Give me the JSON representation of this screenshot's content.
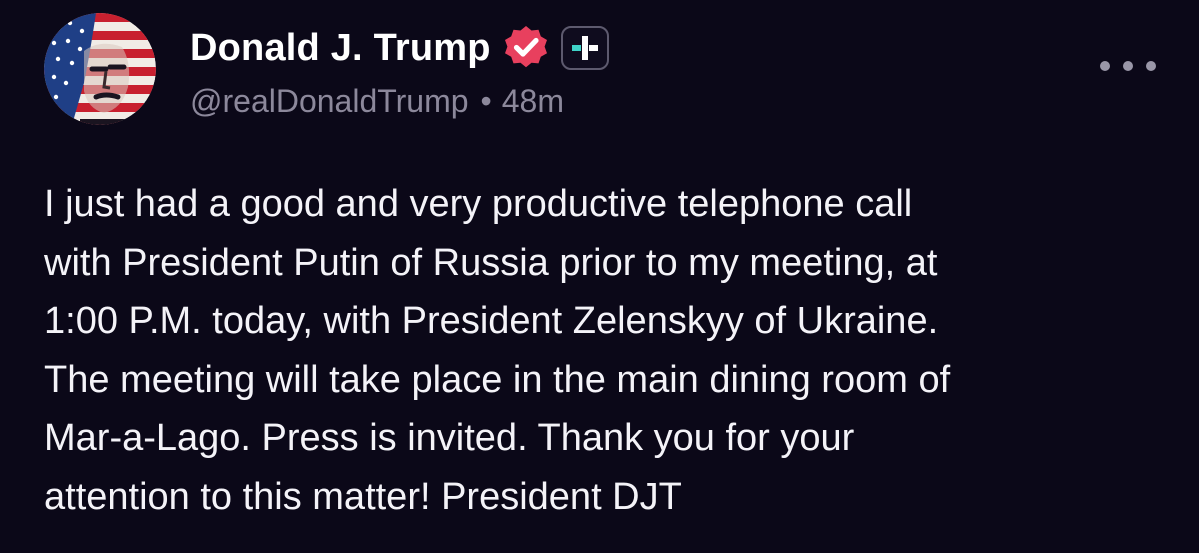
{
  "post": {
    "author": {
      "display_name": "Donald J. Trump",
      "handle": "@realDonaldTrump",
      "verified_icon": "verified-badge-icon",
      "plus_icon": "plus-icon"
    },
    "separator": "•",
    "timestamp": "48m",
    "more_icon": "more-options-icon",
    "text": "I just had a good and very productive telephone call\nwith President Putin of Russia prior to my meeting, at\n1:00 P.M. today, with President Zelenskyy of Ukraine.\nThe meeting will take place in the main dining room of\nMar-a-Lago. Press is invited. Thank you for your\nattention to this matter! President DJT"
  },
  "colors": {
    "background": "#0b0818",
    "verified": "#e8405e",
    "plus_accent": "#3fd3c8",
    "muted_text": "#8c889b"
  }
}
